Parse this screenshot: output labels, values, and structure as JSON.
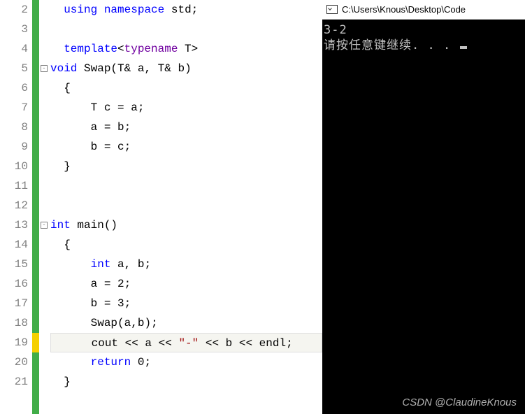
{
  "editor": {
    "line_start": 2,
    "lines": [
      {
        "num": "2",
        "marker": "green",
        "fold": "",
        "tokens": [
          [
            "  ",
            "p"
          ],
          [
            "using",
            "kw"
          ],
          [
            " ",
            "p"
          ],
          [
            "namespace",
            "kw"
          ],
          [
            " ",
            "p"
          ],
          [
            "std",
            "ident"
          ],
          [
            ";",
            "punct"
          ]
        ]
      },
      {
        "num": "3",
        "marker": "green",
        "fold": "",
        "tokens": []
      },
      {
        "num": "4",
        "marker": "green",
        "fold": "",
        "tokens": [
          [
            "  ",
            "p"
          ],
          [
            "template",
            "kw"
          ],
          [
            "<",
            "punct"
          ],
          [
            "typename",
            "typename"
          ],
          [
            " ",
            "p"
          ],
          [
            "T",
            "ident"
          ],
          [
            ">",
            "punct"
          ]
        ]
      },
      {
        "num": "5",
        "marker": "green",
        "fold": "minus",
        "tokens": [
          [
            "void",
            "kw"
          ],
          [
            " ",
            "p"
          ],
          [
            "Swap",
            "ident"
          ],
          [
            "(",
            "punct"
          ],
          [
            "T",
            "ident"
          ],
          [
            "& ",
            "punct"
          ],
          [
            "a",
            "ident"
          ],
          [
            ", ",
            "punct"
          ],
          [
            "T",
            "ident"
          ],
          [
            "& ",
            "punct"
          ],
          [
            "b",
            "ident"
          ],
          [
            ")",
            "punct"
          ]
        ]
      },
      {
        "num": "6",
        "marker": "green",
        "fold": "",
        "tokens": [
          [
            "  {",
            "punct"
          ]
        ]
      },
      {
        "num": "7",
        "marker": "green",
        "fold": "",
        "tokens": [
          [
            "      ",
            "p"
          ],
          [
            "T",
            "ident"
          ],
          [
            " ",
            "p"
          ],
          [
            "c",
            "ident"
          ],
          [
            " = ",
            "punct"
          ],
          [
            "a",
            "ident"
          ],
          [
            ";",
            "punct"
          ]
        ]
      },
      {
        "num": "8",
        "marker": "green",
        "fold": "",
        "tokens": [
          [
            "      ",
            "p"
          ],
          [
            "a",
            "ident"
          ],
          [
            " = ",
            "punct"
          ],
          [
            "b",
            "ident"
          ],
          [
            ";",
            "punct"
          ]
        ]
      },
      {
        "num": "9",
        "marker": "green",
        "fold": "",
        "tokens": [
          [
            "      ",
            "p"
          ],
          [
            "b",
            "ident"
          ],
          [
            " = ",
            "punct"
          ],
          [
            "c",
            "ident"
          ],
          [
            ";",
            "punct"
          ]
        ]
      },
      {
        "num": "10",
        "marker": "green",
        "fold": "",
        "tokens": [
          [
            "  }",
            "punct"
          ]
        ]
      },
      {
        "num": "11",
        "marker": "green",
        "fold": "",
        "tokens": []
      },
      {
        "num": "12",
        "marker": "green",
        "fold": "",
        "tokens": []
      },
      {
        "num": "13",
        "marker": "green",
        "fold": "minus",
        "tokens": [
          [
            "int",
            "kw"
          ],
          [
            " ",
            "p"
          ],
          [
            "main",
            "ident"
          ],
          [
            "()",
            "punct"
          ]
        ]
      },
      {
        "num": "14",
        "marker": "green",
        "fold": "",
        "tokens": [
          [
            "  {",
            "punct"
          ]
        ]
      },
      {
        "num": "15",
        "marker": "green",
        "fold": "",
        "tokens": [
          [
            "      ",
            "p"
          ],
          [
            "int",
            "kw"
          ],
          [
            " ",
            "p"
          ],
          [
            "a",
            "ident"
          ],
          [
            ", ",
            "punct"
          ],
          [
            "b",
            "ident"
          ],
          [
            ";",
            "punct"
          ]
        ]
      },
      {
        "num": "16",
        "marker": "green",
        "fold": "",
        "tokens": [
          [
            "      ",
            "p"
          ],
          [
            "a",
            "ident"
          ],
          [
            " = ",
            "punct"
          ],
          [
            "2",
            "num"
          ],
          [
            ";",
            "punct"
          ]
        ]
      },
      {
        "num": "17",
        "marker": "green",
        "fold": "",
        "tokens": [
          [
            "      ",
            "p"
          ],
          [
            "b",
            "ident"
          ],
          [
            " = ",
            "punct"
          ],
          [
            "3",
            "num"
          ],
          [
            ";",
            "punct"
          ]
        ]
      },
      {
        "num": "18",
        "marker": "green",
        "fold": "",
        "tokens": [
          [
            "      ",
            "p"
          ],
          [
            "Swap",
            "ident"
          ],
          [
            "(",
            "punct"
          ],
          [
            "a",
            "ident"
          ],
          [
            ",",
            "punct"
          ],
          [
            "b",
            "ident"
          ],
          [
            ")",
            "punct"
          ],
          [
            ";",
            "punct"
          ]
        ]
      },
      {
        "num": "19",
        "marker": "yellow",
        "fold": "",
        "highlight": true,
        "tokens": [
          [
            "      ",
            "p"
          ],
          [
            "cout",
            "ident"
          ],
          [
            " << ",
            "punct"
          ],
          [
            "a",
            "ident"
          ],
          [
            " << ",
            "punct"
          ],
          [
            "\"-\"",
            "str"
          ],
          [
            " << ",
            "punct"
          ],
          [
            "b",
            "ident"
          ],
          [
            " << ",
            "punct"
          ],
          [
            "endl",
            "ident"
          ],
          [
            ";",
            "punct"
          ]
        ]
      },
      {
        "num": "20",
        "marker": "green",
        "fold": "",
        "tokens": [
          [
            "      ",
            "p"
          ],
          [
            "return",
            "kw"
          ],
          [
            " ",
            "p"
          ],
          [
            "0",
            "num"
          ],
          [
            ";",
            "punct"
          ]
        ]
      },
      {
        "num": "21",
        "marker": "green",
        "fold": "",
        "tokens": [
          [
            "  }",
            "punct"
          ]
        ]
      }
    ]
  },
  "console": {
    "title": "C:\\Users\\Knous\\Desktop\\Code",
    "output_line1": "3-2",
    "output_line2": "请按任意键继续. . . "
  },
  "watermark": "CSDN @ClaudineKnous"
}
